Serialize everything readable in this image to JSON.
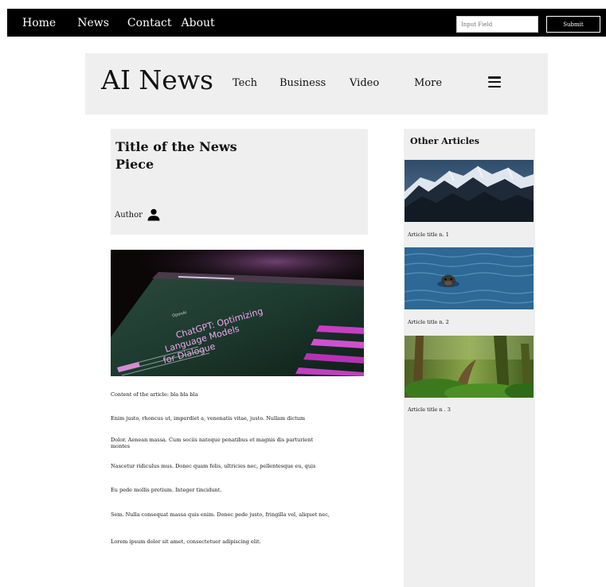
{
  "topbar": {
    "nav": [
      {
        "label": "Home"
      },
      {
        "label": "News"
      },
      {
        "label": "Contact"
      },
      {
        "label": "About"
      }
    ],
    "search": {
      "placeholder": "Input Field",
      "value": ""
    },
    "submit_label": "Submit"
  },
  "header": {
    "brand": "AI News",
    "categories": [
      {
        "label": "Tech"
      },
      {
        "label": "Business"
      },
      {
        "label": "Video"
      },
      {
        "label": "More"
      }
    ],
    "menu_icon": "hamburger-menu-icon"
  },
  "article": {
    "title": "Title of the News Piece",
    "author_label": "Author",
    "author_icon": "person-icon",
    "hero_image": {
      "screen_text": "ChatGPT: Optimizing Language Models for Dialogue",
      "logo_text": "OpenAI"
    },
    "paragraphs": [
      "Content of the article: bla bla bla",
      "Enim justo, rhoncus ut, imperdiet a, venenatis vitae, justo. Nullam dictum",
      "Dolor. Aenean massa. Cum sociis natoque penatibus et magnis dis parturient montes",
      "Nascetur ridiculus mus. Donec quam felis, ultricies nec, pellentesque eu, quis",
      "Eu pede mollis pretium. Integer tincidunt.",
      "Sem. Nulla consequat massa quis enim. Donec pede justo, fringilla vel, aliquet nec,",
      "Lorem ipsum dolor sit amet, consectetuer adipiscing elit."
    ]
  },
  "sidebar": {
    "title": "Other Articles",
    "articles": [
      {
        "caption": "Article title n. 1",
        "image": "snowy-mountains"
      },
      {
        "caption": "Article title n. 2",
        "image": "seal-in-water"
      },
      {
        "caption": "Article title n . 3",
        "image": "mossy-forest"
      }
    ]
  }
}
